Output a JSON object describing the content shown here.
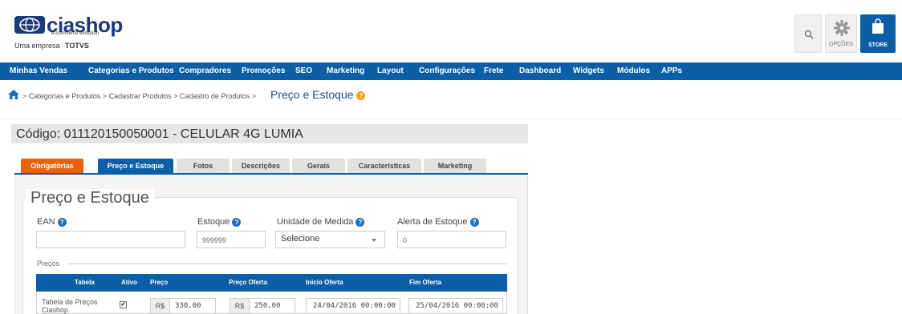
{
  "brand": {
    "logo_name": "ciashop",
    "tagline": "e-commerce evolution",
    "sub_prefix": "Uma empresa",
    "sub_company": "TOTVS"
  },
  "header_buttons": {
    "search_icon": "search-icon",
    "options_label": "OPÇÕES",
    "store_label": "STORE"
  },
  "nav": {
    "items": [
      "Minhas Vendas",
      "Categorias e Produtos",
      "Compradores",
      "Promoções",
      "SEO",
      "Marketing",
      "Layout",
      "Configurações",
      "Frete",
      "Dashboard",
      "Widgets",
      "Módulos",
      "APPs"
    ]
  },
  "breadcrumb": {
    "path": "> Categorias e Produtos > Cadastrar Produtos > Cadastro de Produtos >",
    "current": "Preço e Estoque"
  },
  "product": {
    "code_line": "Código: 011120150050001 - CELULAR 4G LUMIA"
  },
  "tabs": [
    "Obrigatórias",
    "Preço e Estoque",
    "Fotos",
    "Descrições",
    "Gerais",
    "Características",
    "Marketing"
  ],
  "form": {
    "legend": "Preço e Estoque",
    "ean_label": "EAN",
    "ean_value": "",
    "estoque_label": "Estoque",
    "estoque_value": "999999",
    "unidade_label": "Unidade de Medida",
    "unidade_value": "Selecione",
    "alerta_label": "Alerta de Estoque",
    "alerta_value": "0",
    "help_glyph": "?"
  },
  "precos": {
    "label": "Preços",
    "headers": [
      "Tabela",
      "Ativo",
      "Preço",
      "Preço Oferta",
      "Início Oferta",
      "Fim Oferta"
    ],
    "rows": [
      {
        "tabela": "Tabela de Preços Ciashop",
        "ativo": true,
        "currency": "R$",
        "preco": "330,00",
        "preco_oferta": "250,00",
        "inicio": "24/04/2016 00:00:00",
        "fim": "25/04/2016 00:00:00"
      }
    ]
  },
  "colors": {
    "primary": "#0a5fa8",
    "tab_active_required": "#e8620c",
    "help_blue": "#1f6fbf",
    "help_orange": "#f0a30a"
  }
}
